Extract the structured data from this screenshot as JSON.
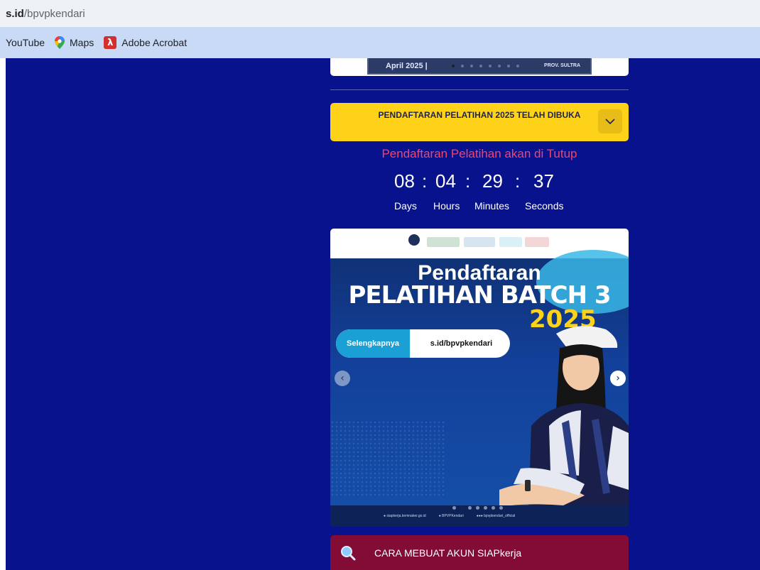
{
  "browser": {
    "url_host": "s.id",
    "url_path": "/bpvpkendari",
    "bookmarks": [
      {
        "label": "YouTube",
        "icon": "none"
      },
      {
        "label": "Maps",
        "icon": "maps-pin-icon"
      },
      {
        "label": "Adobe Acrobat",
        "icon": "adobe-acrobat-icon"
      }
    ]
  },
  "top_banner": {
    "date_text": "April 2025",
    "sep": "|",
    "prov_text": "PROV. SULTRA"
  },
  "accordion": {
    "title": "PENDAFTARAN PELATIHAN 2025 TELAH DIBUKA",
    "icon": "chevron-down-icon"
  },
  "countdown": {
    "heading": "Pendaftaran Pelatihan akan di Tutup",
    "values": {
      "days": "08",
      "hours": "04",
      "minutes": "29",
      "seconds": "37"
    },
    "separator": ":",
    "labels": {
      "days": "Days",
      "hours": "Hours",
      "minutes": "Minutes",
      "seconds": "Seconds"
    }
  },
  "slide": {
    "line1": "Pendaftaran",
    "line2": "PELATIHAN BATCH 3",
    "year": "2025",
    "pill_left": "Selengkapnya",
    "pill_right": "s.id/bpvpkendari",
    "prev_icon": "chevron-left-icon",
    "next_icon": "chevron-right-icon",
    "indicator_count": 7,
    "active_indicator": 1
  },
  "howto": {
    "label": "CARA MEBUAT AKUN SIAPkerja",
    "icon": "search-icon"
  },
  "colors": {
    "page_bg": "#07128c",
    "accordion_bg": "#ffd21a",
    "countdown_heading": "#f2456a",
    "howto_bg": "#820c35"
  }
}
